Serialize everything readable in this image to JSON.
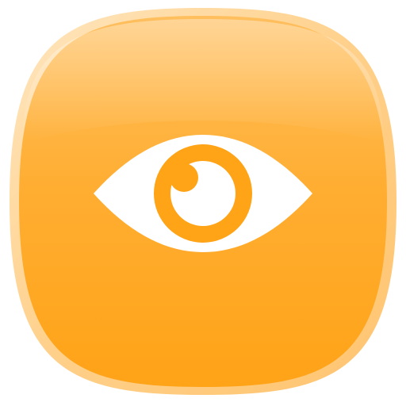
{
  "icon": {
    "name": "eye-icon",
    "description_colors": {
      "outer_rim": "#ffd9a0",
      "body_top": "#ffbf5e",
      "body_mid": "#ffae33",
      "body_bottom": "#ffa317",
      "glyph": "#ffffff"
    }
  }
}
